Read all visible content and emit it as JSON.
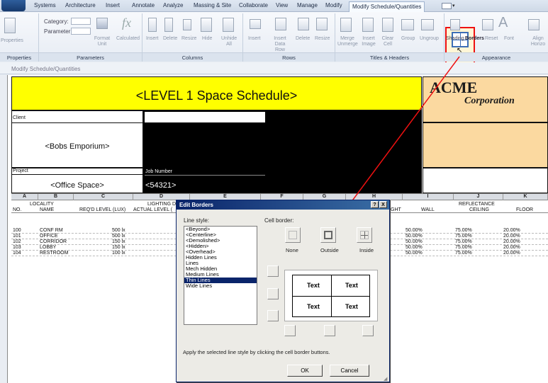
{
  "menu": [
    "Systems",
    "Architecture",
    "Insert",
    "Annotate",
    "Analyze",
    "Massing & Site",
    "Collaborate",
    "View",
    "Manage",
    "Modify",
    "Modify Schedule/Quantities"
  ],
  "ribbon": {
    "category_label": "Category:",
    "parameter_label": "Parameter:",
    "properties_label": "Properties",
    "format_unit": "Format Unit",
    "calculated": "Calculated",
    "col_buttons": [
      "Insert",
      "Delete",
      "Resize",
      "Hide",
      "Unhide All"
    ],
    "row_buttons": [
      "Insert",
      "Insert Data Row",
      "Delete",
      "Resize"
    ],
    "th_buttons": [
      "Merge Unmerge",
      "Insert Image",
      "Clear Cell",
      "Group",
      "Ungroup"
    ],
    "app_buttons": [
      "Shading",
      "Borders",
      "Reset",
      "Font",
      "Align Horizo"
    ],
    "panels": [
      "Properties",
      "Parameters",
      "Columns",
      "Rows",
      "Titles & Headers",
      "Appearance"
    ]
  },
  "context_label": "Modify Schedule/Quantities",
  "schedule": {
    "title": "<LEVEL 1 Space Schedule>",
    "logo_line1": "ACME",
    "logo_line2": "Corporation",
    "client_label": "Client",
    "client_value": "<Bobs Emporium>",
    "project_label": "Project",
    "project_value": "<Office Space>",
    "job_label": "Job Number",
    "job_value": "<54321>",
    "col_letters": [
      "A",
      "B",
      "C",
      "D",
      "E",
      "F",
      "G",
      "H",
      "I",
      "J",
      "K"
    ],
    "group_headers": {
      "locality": "LOCALITY",
      "lighting": "LIGHTING D",
      "reflectance": "REFLECTANCE"
    },
    "headers": [
      "NO.",
      "NAME",
      "REQ'D LEVEL (LUX)",
      "ACTUAL LEVEL (",
      "GHT",
      "WALL",
      "CEILING",
      "FLOOR"
    ],
    "rows": [
      {
        "no": "100",
        "name": "CONF RM",
        "lux": "500 lx",
        "wall": "50.00%",
        "ceiling": "75.00%",
        "floor": "20.00%"
      },
      {
        "no": "101",
        "name": "OFFICE",
        "lux": "500 lx",
        "wall": "50.00%",
        "ceiling": "75.00%",
        "floor": "20.00%"
      },
      {
        "no": "102",
        "name": "CORRIDOR",
        "lux": "150 lx",
        "wall": "50.00%",
        "ceiling": "75.00%",
        "floor": "20.00%"
      },
      {
        "no": "103",
        "name": "LOBBY",
        "lux": "150 lx",
        "wall": "50.00%",
        "ceiling": "75.00%",
        "floor": "20.00%"
      },
      {
        "no": "104",
        "name": "RESTROOM",
        "lux": "100 lx",
        "wall": "50.00%",
        "ceiling": "75.00%",
        "floor": "20.00%"
      }
    ]
  },
  "dialog": {
    "title": "Edit Borders",
    "help": "?",
    "close": "X",
    "line_style_label": "Line style:",
    "cell_border_label": "Cell border:",
    "line_styles": [
      "<Beyond>",
      "<Centerline>",
      "<Demolished>",
      "<Hidden>",
      "<Overhead>",
      "Hidden Lines",
      "Lines",
      "Mech Hidden",
      "Medium Lines",
      "Thin Lines",
      "Wide Lines"
    ],
    "selected_style": "Thin Lines",
    "preset_labels": [
      "None",
      "Outside",
      "Inside"
    ],
    "preview_text": [
      "Text",
      "Text",
      "Text",
      "Text"
    ],
    "instructions": "Apply the selected line style by clicking the cell border buttons.",
    "ok": "OK",
    "cancel": "Cancel"
  }
}
